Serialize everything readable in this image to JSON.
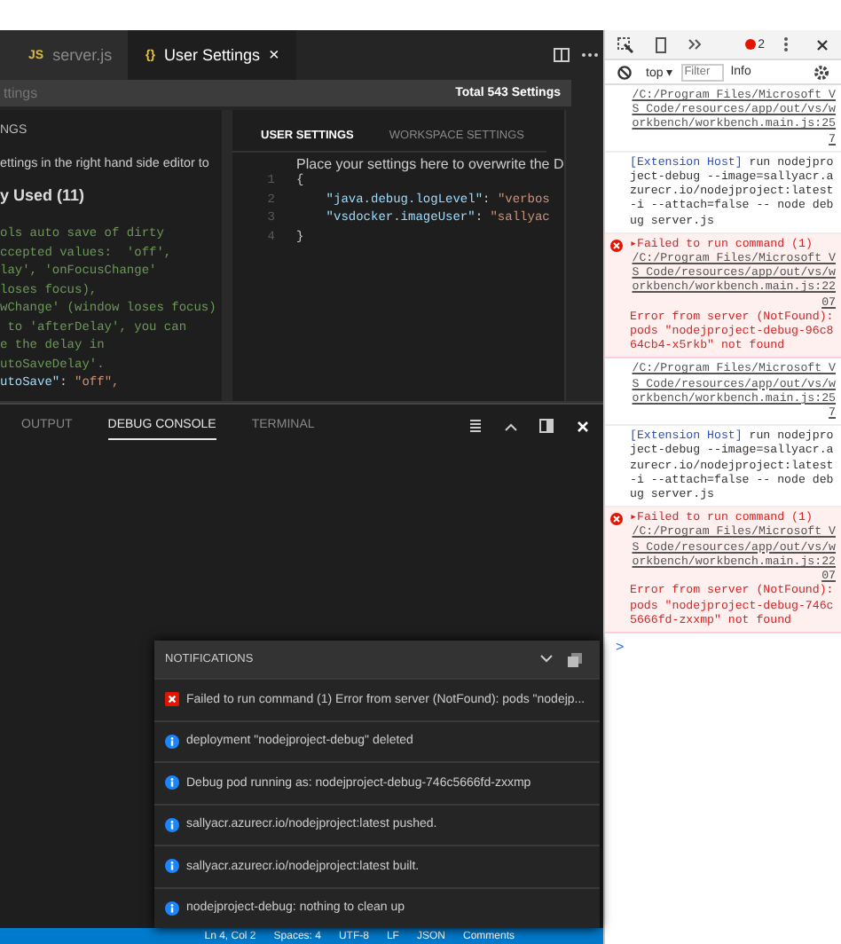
{
  "editor_tabs": [
    {
      "icon": "JS",
      "label": "server.js",
      "selected": false
    },
    {
      "icon": "{}",
      "label": "User Settings",
      "selected": true,
      "close": "×"
    }
  ],
  "search": {
    "placeholder": "ttings",
    "total": "Total 543 Settings"
  },
  "default_settings": {
    "header": "NGS",
    "hint": "ettings in the right hand side editor to",
    "group": "y Used (11)",
    "lines": [
      {
        "kind": "comment",
        "text": "ols auto save of dirty"
      },
      {
        "kind": "comment",
        "text": "ccepted values:  'off',"
      },
      {
        "kind": "comment",
        "text": "lay', 'onFocusChange'"
      },
      {
        "kind": "comment",
        "text": "loses focus),"
      },
      {
        "kind": "comment",
        "text": "wChange' (window loses focus)"
      },
      {
        "kind": "comment",
        "text": " to 'afterDelay', you can"
      },
      {
        "kind": "comment",
        "text": "e the delay in"
      },
      {
        "kind": "comment",
        "text": "utoSaveDelay'."
      },
      {
        "kind": "setting",
        "key": "utoSave\"",
        "colon": ":",
        "value": "\"off\","
      }
    ]
  },
  "user_settings": {
    "tabs": [
      {
        "label": "USER SETTINGS",
        "selected": true
      },
      {
        "label": "WORKSPACE SETTINGS",
        "selected": false
      }
    ],
    "hint": "Place your settings here to overwrite the D",
    "lines": [
      {
        "number": "1",
        "kind": "brace",
        "text": "{"
      },
      {
        "number": "2",
        "kind": "setting",
        "key": "\"java.debug.logLevel\"",
        "colon": ":",
        "value": "\"verbos"
      },
      {
        "number": "3",
        "kind": "setting",
        "key": "\"vsdocker.imageUser\"",
        "colon": ":",
        "value": "\"sallyac"
      },
      {
        "number": "4",
        "kind": "brace",
        "text": "}"
      }
    ]
  },
  "panel": {
    "tabs": [
      {
        "label": "OUTPUT",
        "selected": false
      },
      {
        "label": "DEBUG CONSOLE",
        "selected": true
      },
      {
        "label": "TERMINAL",
        "selected": false
      }
    ]
  },
  "notifications": {
    "title": "NOTIFICATIONS",
    "items": [
      {
        "kind": "error",
        "text": "Failed to run command (1) Error from server (NotFound): pods \"nodejp..."
      },
      {
        "kind": "info",
        "text": "deployment \"nodejproject-debug\" deleted"
      },
      {
        "kind": "info",
        "text": "Debug pod running as: nodejproject-debug-746c5666fd-zxxmp"
      },
      {
        "kind": "info",
        "text": "sallyacr.azurecr.io/nodejproject:latest pushed."
      },
      {
        "kind": "info",
        "text": "sallyacr.azurecr.io/nodejproject:latest built."
      },
      {
        "kind": "info",
        "text": "nodejproject-debug: nothing to clean up"
      }
    ]
  },
  "status_bar": [
    "Ln 4, Col 2",
    "Spaces: 4",
    "UTF-8",
    "LF",
    "JSON",
    "Comments"
  ],
  "devtools": {
    "error_count": "2",
    "context": "top",
    "context_caret": "▾",
    "filter_placeholder": "Filter",
    "level": "Info",
    "messages": [
      {
        "kind": "link",
        "text": "/C:/Program Files/Microsoft VS Code/resources/app/out/vs/workbench/workbench.main.js:257"
      },
      {
        "kind": "log",
        "source": "[Extension Host]",
        "text": " run nodejproject-debug --image=sallyacr.azurecr.io/nodejproject:latest -i --attach=false -- node debug server.js"
      },
      {
        "kind": "error",
        "expander": "▸",
        "title": "Failed to run command (1)",
        "link": "/C:/Program Files/Microsoft VS Code/resources/app/out/vs/workbench/workbench.main.js:2207",
        "text": "Error from server (NotFound): pods \"nodejproject-debug-96c864cb4-x5rkb\" not found"
      },
      {
        "kind": "link",
        "text": "/C:/Program Files/Microsoft VS Code/resources/app/out/vs/workbench/workbench.main.js:257"
      },
      {
        "kind": "log",
        "source": "[Extension Host]",
        "text": " run nodejproject-debug --image=sallyacr.azurecr.io/nodejproject:latest -i --attach=false -- node debug server.js"
      },
      {
        "kind": "error",
        "expander": "▸",
        "title": "Failed to run command (1)",
        "link": "/C:/Program Files/Microsoft VS Code/resources/app/out/vs/workbench/workbench.main.js:2207",
        "text": "Error from server (NotFound): pods \"nodejproject-debug-746c5666fd-zxxmp\" not found"
      }
    ],
    "prompt": ">"
  }
}
